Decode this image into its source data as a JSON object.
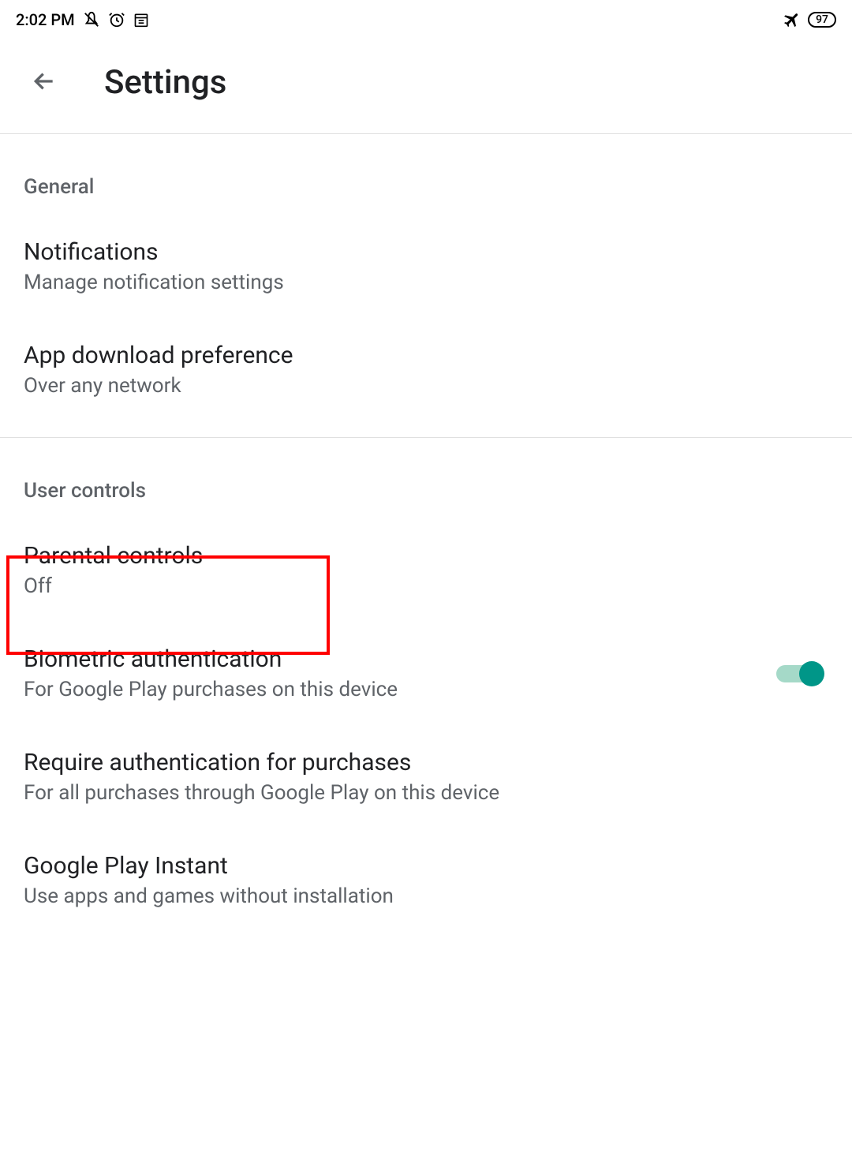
{
  "status": {
    "time": "2:02 PM",
    "battery": "97"
  },
  "header": {
    "title": "Settings"
  },
  "sections": {
    "general": {
      "label": "General",
      "notifications": {
        "title": "Notifications",
        "subtitle": "Manage notification settings"
      },
      "appDownload": {
        "title": "App download preference",
        "subtitle": "Over any network"
      }
    },
    "userControls": {
      "label": "User controls",
      "parental": {
        "title": "Parental controls",
        "subtitle": "Off"
      },
      "biometric": {
        "title": "Biometric authentication",
        "subtitle": "For Google Play purchases on this device",
        "enabled": true
      },
      "requireAuth": {
        "title": "Require authentication for purchases",
        "subtitle": "For all purchases through Google Play on this device"
      },
      "playInstant": {
        "title": "Google Play Instant",
        "subtitle": "Use apps and games without installation"
      }
    }
  }
}
